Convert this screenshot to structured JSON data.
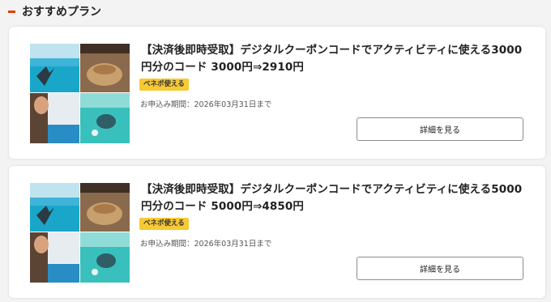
{
  "section": {
    "title": "おすすめプラン",
    "accent_color": "#e8380d"
  },
  "plans": [
    {
      "title": "【決済後即時受取】デジタルクーポンコードでアクティビティに使える3000円分のコード 3000円⇒2910円",
      "badge": "ベネポ使える",
      "deadline": "お申込み期間：2026年03月31日まで",
      "button_label": "詳細を見る",
      "image_icon": "activity-collage-photo"
    },
    {
      "title": "【決済後即時受取】デジタルクーポンコードでアクティビティに使える5000円分のコード 5000円⇒4850円",
      "badge": "ベネポ使える",
      "deadline": "お申込み期間：2026年03月31日まで",
      "button_label": "詳細を見る",
      "image_icon": "activity-collage-photo"
    }
  ],
  "colors": {
    "badge_bg": "#f7c934",
    "card_bg": "#ffffff",
    "page_bg": "#f3f3f3"
  }
}
